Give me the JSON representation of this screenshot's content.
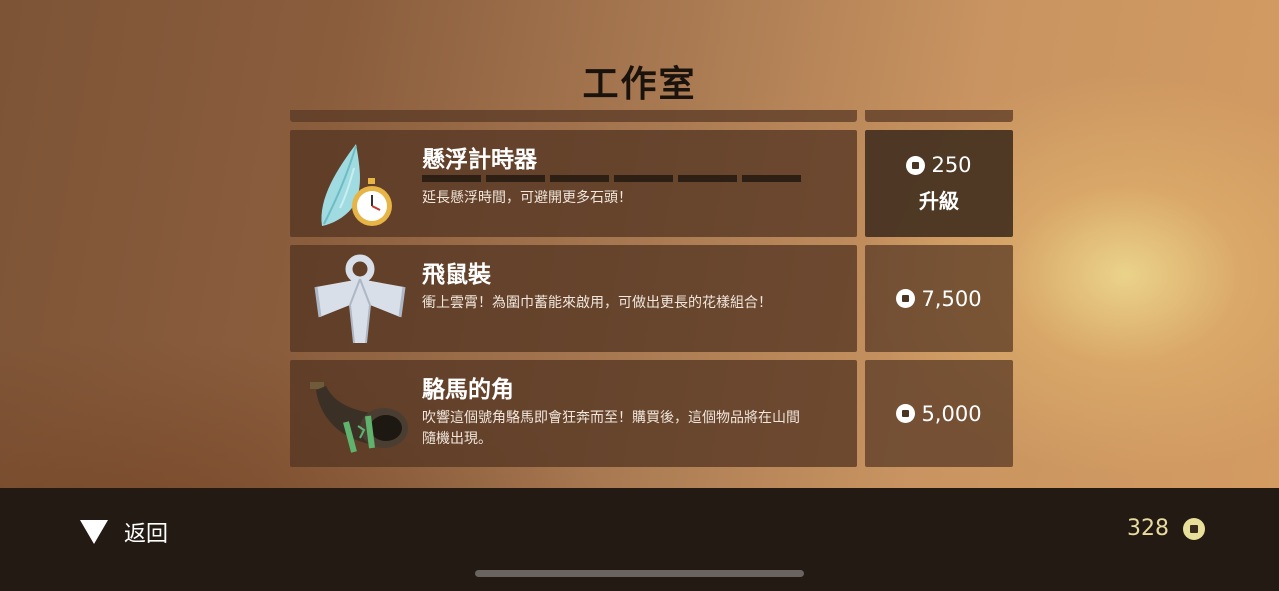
{
  "title": "工作室",
  "items": [
    {
      "name": "懸浮計時器",
      "description": "延長懸浮時間，可避開更多石頭！",
      "progress_segments_filled": 0,
      "progress_segments_total": 6,
      "price": "250",
      "action": "升級",
      "icon": "feather-stopwatch-icon"
    },
    {
      "name": "飛鼠裝",
      "description": "衝上雲霄！為圍巾蓄能來啟用，可做出更長的花樣組合！",
      "price": "7,500",
      "icon": "wingsuit-icon"
    },
    {
      "name": "駱馬的角",
      "description_lines": [
        "吹響這個號角駱馬即會狂奔而至！購買後，這個物品將在山間",
        "隨機出現。"
      ],
      "price": "5,000",
      "icon": "horn-icon"
    }
  ],
  "footer": {
    "back_label": "返回",
    "coin_balance": "328"
  },
  "colors": {
    "panel": "#543622",
    "footer": "#241a14",
    "balance_text": "#e8dba0"
  }
}
